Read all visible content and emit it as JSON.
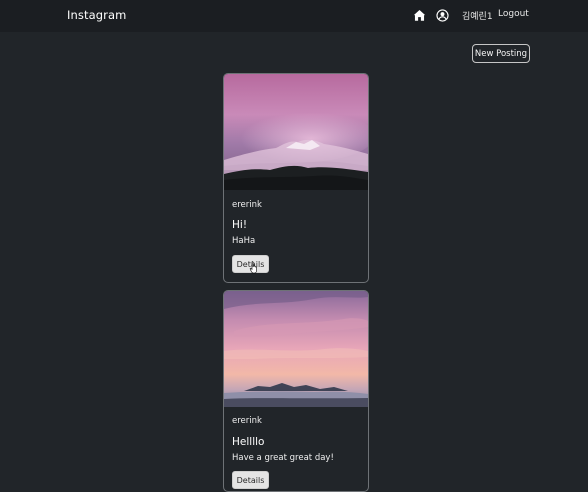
{
  "navbar": {
    "brand": "Instagram",
    "home_icon": "home-icon",
    "profile_icon": "user-circle-icon",
    "username": "김예린1",
    "logout_label": "Logout"
  },
  "toolbar": {
    "new_posting_label": "New Posting"
  },
  "posts": [
    {
      "user": "ererink",
      "title": "Hi!",
      "body": "HaHa",
      "details_label": "Details"
    },
    {
      "user": "ererink",
      "title": "Hellllo",
      "body": "Have a great great day!",
      "details_label": "Details"
    }
  ],
  "colors": {
    "background": "#212529",
    "navbar": "#1b1e22",
    "card_border": "#6e7276",
    "button_light": "#e4e4e4"
  }
}
